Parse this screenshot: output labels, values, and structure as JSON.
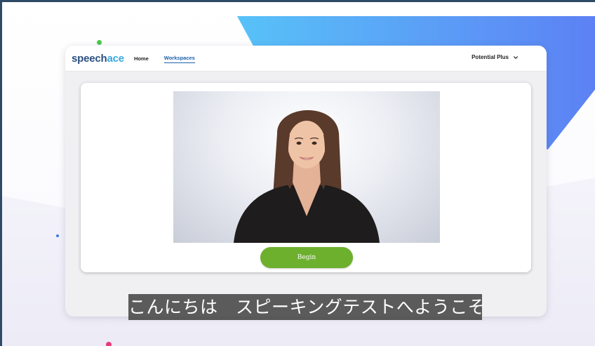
{
  "nav": {
    "logo_main": "speech",
    "logo_accent": "ace",
    "links": [
      "Home",
      "Workspaces"
    ],
    "account_label": "Potential Plus",
    "account_icon": "chevron-down-icon"
  },
  "main": {
    "video_subject": "presenter-avatar",
    "begin_label": "Begin"
  },
  "subtitle": {
    "text": "こんにちは　スピーキングテストへようこそ"
  },
  "colors": {
    "brand_dark": "#2a4f7f",
    "brand_light": "#39a8e0",
    "begin_button": "#6db02e",
    "accent_blue": "#58c2f8"
  }
}
